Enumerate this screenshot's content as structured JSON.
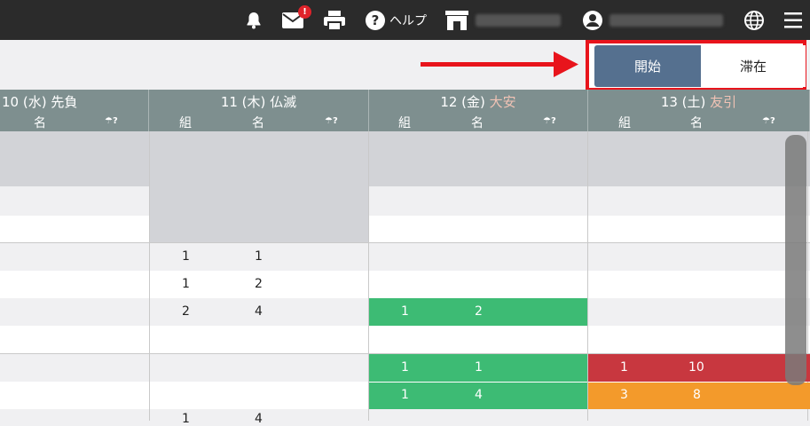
{
  "topbar": {
    "help_label": "ヘルプ",
    "mail_badge": "!",
    "icons": [
      "bell-icon",
      "mail-icon",
      "printer-icon",
      "help-icon",
      "store-icon",
      "user-icon",
      "globe-icon",
      "menu-icon"
    ]
  },
  "toggle": {
    "start_label": "開始",
    "stay_label": "滞在"
  },
  "columns": [
    {
      "date": "10 (水)",
      "rokuyo": "先負",
      "rokuyo_colored": false,
      "sub": [
        "名"
      ]
    },
    {
      "date": "11 (木)",
      "rokuyo": "仏滅",
      "rokuyo_colored": false,
      "sub": [
        "組",
        "名"
      ]
    },
    {
      "date": "12 (金)",
      "rokuyo": "大安",
      "rokuyo_colored": true,
      "sub": [
        "組",
        "名"
      ]
    },
    {
      "date": "13 (土)",
      "rokuyo": "友引",
      "rokuyo_colored": true,
      "sub": [
        "組",
        "名"
      ]
    }
  ],
  "umbrella_label": "☂?",
  "cells": {
    "c11_r1": [
      "1",
      "1"
    ],
    "c11_r2": [
      "1",
      "2"
    ],
    "c11_r3": [
      "2",
      "4"
    ],
    "c11_r8": [
      "1",
      "4"
    ],
    "c12_r3": [
      "1",
      "2"
    ],
    "c12_r5": [
      "1",
      "1"
    ],
    "c12_r6": [
      "1",
      "4"
    ],
    "c13_r5": [
      "1",
      "10"
    ],
    "c13_r6": [
      "3",
      "8"
    ]
  },
  "colors": {
    "topbar": "#2b2b2b",
    "header": "#7e8f8f",
    "green": "#3dbb74",
    "red": "#c8373f",
    "orange": "#f39a2b",
    "active_toggle": "#55708f",
    "highlight": "#e8141c"
  }
}
